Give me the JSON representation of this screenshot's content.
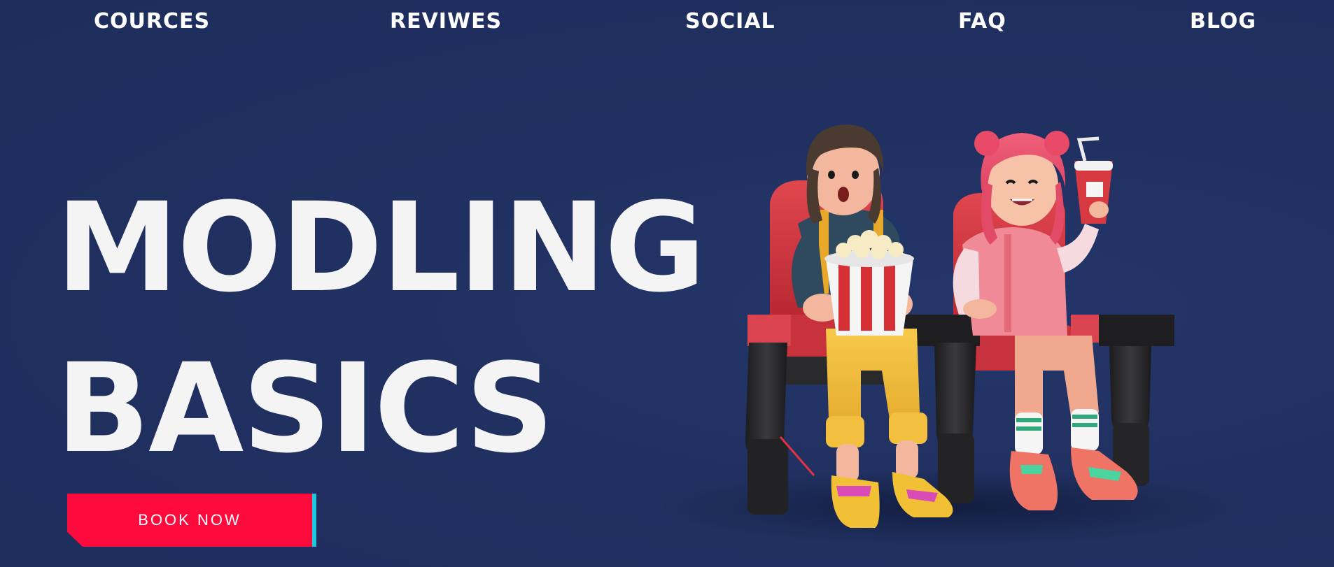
{
  "nav": {
    "items": [
      {
        "label": "COURCES"
      },
      {
        "label": "REVIWES"
      },
      {
        "label": "SOCIAL"
      },
      {
        "label": "FAQ"
      },
      {
        "label": "BLOG"
      }
    ]
  },
  "hero": {
    "headline_line1": "MODLING",
    "headline_line2": "BASICS",
    "cta_label": "BOOK NOW"
  },
  "colors": {
    "background": "#1f2f5f",
    "headline": "#f4f4f4",
    "cta_fill": "#ff0a3c",
    "cta_accent": "#1ec6e0"
  },
  "illustration": {
    "subject": "two-girls-in-cinema-seats-with-popcorn-and-soda"
  }
}
